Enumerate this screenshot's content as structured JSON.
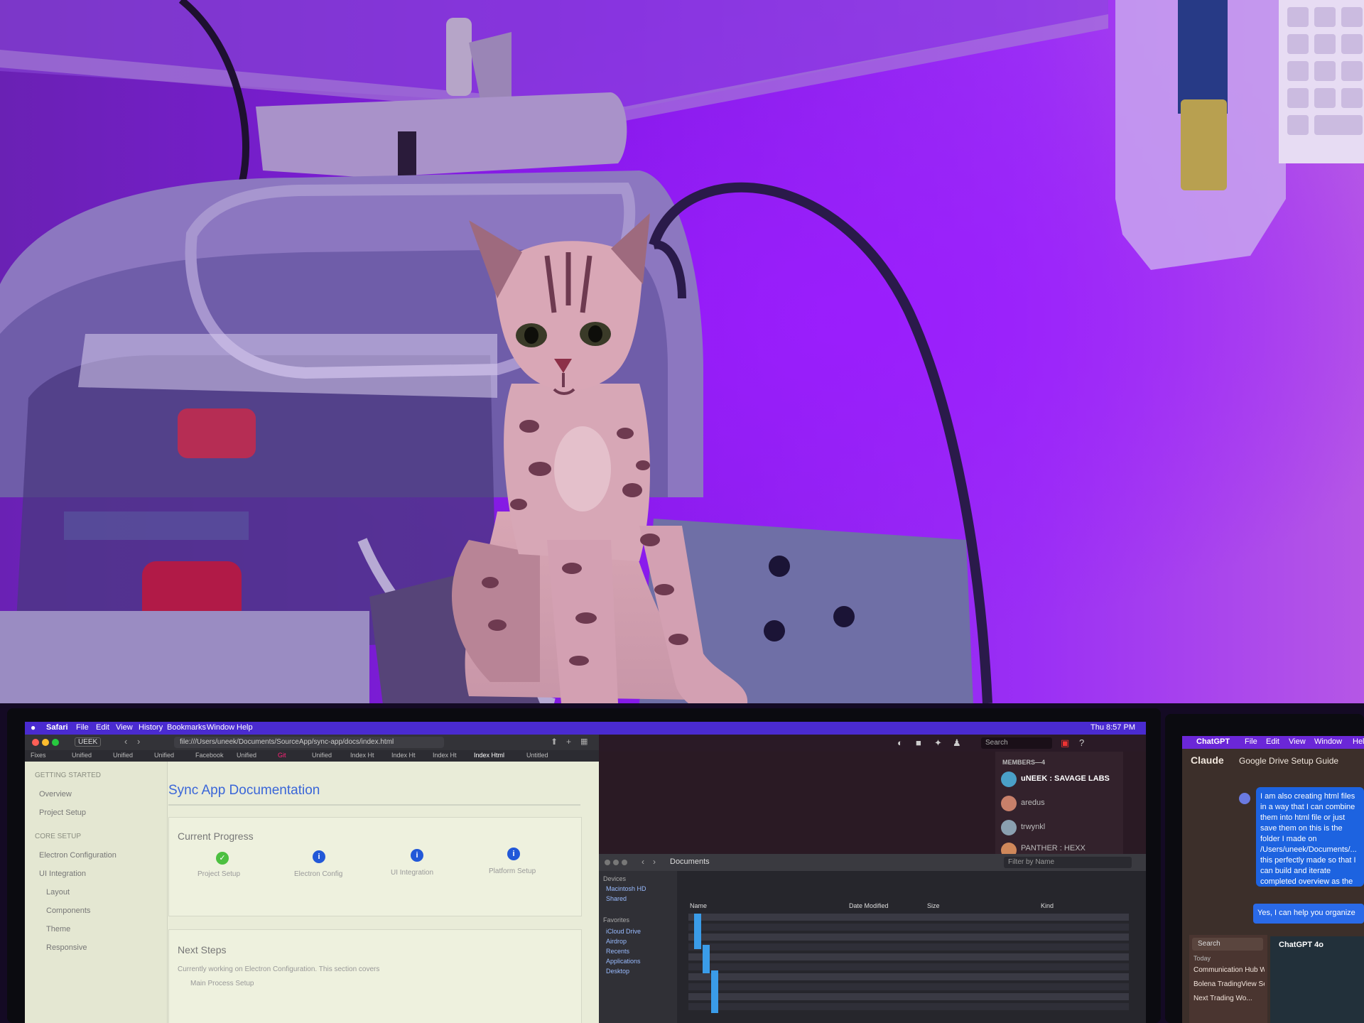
{
  "scene": {
    "subject": "kitten",
    "background_light_color": "#8a1cf0",
    "carrier_color": "#c9c4dc"
  },
  "menubar": {
    "app": "Safari",
    "items": [
      "File",
      "Edit",
      "View",
      "History",
      "Bookmarks",
      "Window",
      "Help"
    ],
    "clock": "Thu 8:57 PM"
  },
  "browser": {
    "tab_label": "UEEK",
    "address": "file:///Users/uneek/Documents/SourceApp/sync-app/docs/index.html",
    "tabs": [
      "Fixes",
      "Unified",
      "Unified",
      "Unified",
      "Facebook",
      "Unified",
      "Git",
      "Unified",
      "Index Ht",
      "Index Ht",
      "Index Ht",
      "Index Html",
      "Untitled"
    ]
  },
  "docs": {
    "sidebar_sections": [
      {
        "heading": "GETTING STARTED",
        "items": [
          "Overview",
          "Project Setup"
        ]
      },
      {
        "heading": "CORE SETUP",
        "items": [
          "Electron Configuration",
          "UI Integration",
          "Layout",
          "Components",
          "Theme",
          "Responsive"
        ]
      }
    ],
    "title": "Sync App Documentation",
    "progress_heading": "Current Progress",
    "steps": [
      {
        "label": "Project Setup",
        "status": "done",
        "glyph": "✓"
      },
      {
        "label": "Electron Config",
        "status": "active",
        "glyph": "i"
      },
      {
        "label": "UI Integration",
        "status": "active",
        "glyph": "i"
      },
      {
        "label": "Platform Setup",
        "status": "active",
        "glyph": "i"
      }
    ],
    "next_heading": "Next Steps",
    "next_text": "Currently working on Electron Configuration. This section covers",
    "next_bullet": "Main Process Setup"
  },
  "discord": {
    "search_placeholder": "Search",
    "members_heading": "MEMBERS—4",
    "members": [
      {
        "name": "uNEEK : SAVAGE LABS",
        "avatar_color": "#4aa0c8"
      },
      {
        "name": "aredus",
        "avatar_color": "#c8806a"
      },
      {
        "name": "trwynkl",
        "avatar_color": "#8aa0b0"
      },
      {
        "name": "PANTHER : HEXX",
        "avatar_color": "#d0885a"
      }
    ]
  },
  "finder": {
    "title": "Documents",
    "filter_placeholder": "Filter by Name",
    "sidebar": [
      "Devices",
      "Macintosh HD",
      "Shared",
      "Favorites",
      "iCloud Drive",
      "Airdrop",
      "Recents",
      "Applications",
      "Desktop"
    ],
    "columns": [
      "Name",
      "Date Modified",
      "Size",
      "Kind"
    ]
  },
  "claude": {
    "menubar": [
      "ChatGPT",
      "File",
      "Edit",
      "View",
      "Window",
      "Help"
    ],
    "app_name": "Claude",
    "conversation_title": "Google Drive Setup Guide",
    "user_message": "I am also creating html files in a way that I can combine them into html file or just save them on this is the folder I made on /Users/uneek/Documents/... this perfectly made so that I can build and iterate completed overview as the",
    "reply_start": "Yes, I can help you organize",
    "search_placeholder": "Search",
    "history_label": "Today",
    "history": [
      "Communication Hub W...",
      "Bolena TradingView Se...",
      "Next Trading Wo..."
    ],
    "panel_title": "ChatGPT 4o"
  }
}
